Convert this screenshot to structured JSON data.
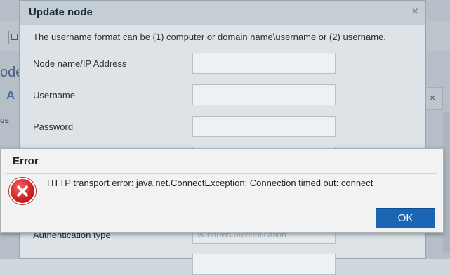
{
  "background": {
    "heading": "ode",
    "tab": "A",
    "column": "us",
    "close": "×"
  },
  "update_node": {
    "title": "Update node",
    "close": "×",
    "hint": "The username format can be (1) computer or domain name\\username or (2) username.",
    "fields": {
      "node": {
        "label": "Node name/IP Address",
        "value": ""
      },
      "username": {
        "label": "Username",
        "value": ""
      },
      "password": {
        "label": "Password",
        "value": ""
      },
      "auth": {
        "label": "Authentication type",
        "value": "Windows authentication"
      }
    }
  },
  "error": {
    "title": "Error",
    "message": "HTTP transport error: java.net.ConnectException: Connection timed out: connect",
    "ok_label": "OK"
  },
  "colors": {
    "ok_button": "#1a66b5",
    "error_icon": "#d62020"
  }
}
